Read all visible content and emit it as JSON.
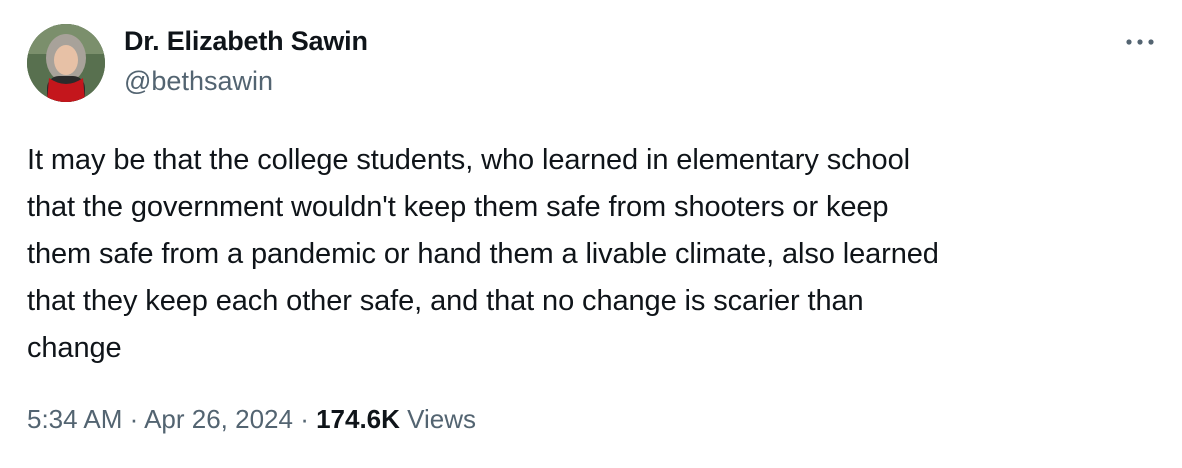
{
  "author": {
    "name": "Dr. Elizabeth Sawin",
    "handle": "@bethsawin",
    "avatar_icon": "profile-photo"
  },
  "more_icon": "more-horizontal-icon",
  "tweet": {
    "text": "It may be that the college students, who learned in elementary school\nthat the government wouldn't keep them safe from shooters or keep\nthem safe from a pandemic or hand them a livable climate, also learned\nthat they keep each other safe, and that no change is scarier than\nchange"
  },
  "meta": {
    "time": "5:34 AM",
    "separator": " · ",
    "date": "Apr 26, 2024",
    "views_count": "174.6K",
    "views_label": "Views"
  },
  "colors": {
    "text": "#0f1419",
    "secondary": "#536471",
    "scarf": "#c4161c"
  }
}
